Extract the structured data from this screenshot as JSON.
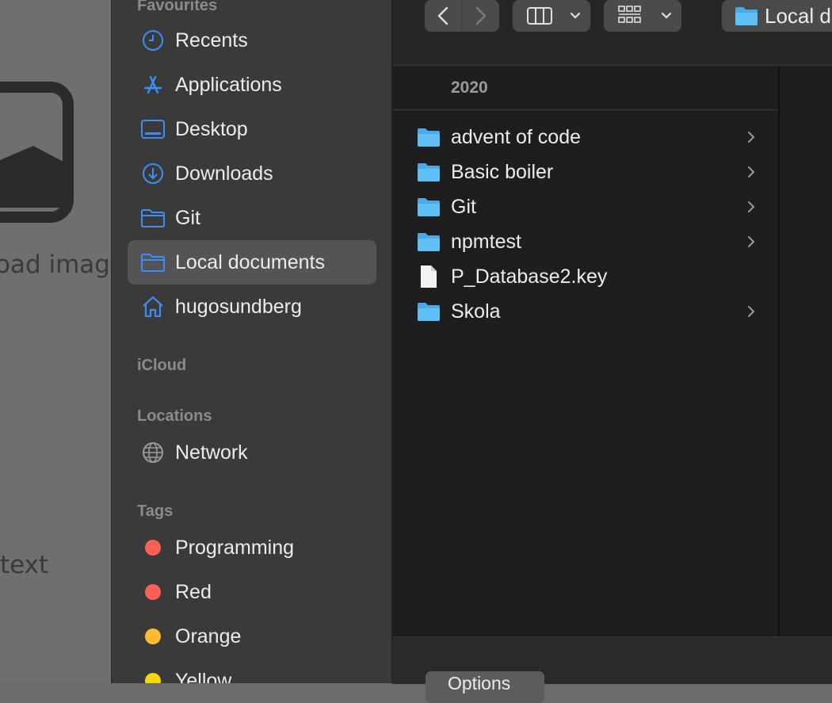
{
  "background": {
    "upload_text": "oad image",
    "text_label": "text"
  },
  "sidebar": {
    "favourites_title": "Favourites",
    "favourites": [
      {
        "label": "Recents",
        "icon": "clock-icon"
      },
      {
        "label": "Applications",
        "icon": "applications-icon"
      },
      {
        "label": "Desktop",
        "icon": "desktop-icon"
      },
      {
        "label": "Downloads",
        "icon": "downloads-icon"
      },
      {
        "label": "Git",
        "icon": "folder-icon"
      },
      {
        "label": "Local documents",
        "icon": "folder-icon",
        "selected": true
      },
      {
        "label": "hugosundberg",
        "icon": "home-icon"
      }
    ],
    "icloud_title": "iCloud",
    "locations_title": "Locations",
    "locations": [
      {
        "label": "Network",
        "icon": "globe-icon"
      }
    ],
    "tags_title": "Tags",
    "tags": [
      {
        "label": "Programming",
        "color": "#ff5f57"
      },
      {
        "label": "Red",
        "color": "#ff5f57"
      },
      {
        "label": "Orange",
        "color": "#febc2e"
      },
      {
        "label": "Yellow",
        "color": "#f5d90a"
      }
    ]
  },
  "toolbar": {
    "back_icon": "chevron-left-icon",
    "forward_icon": "chevron-right-icon",
    "view_icon": "columns-view-icon",
    "group_icon": "grid-group-icon",
    "path_label": "Local documents"
  },
  "column": {
    "header": "2020",
    "items": [
      {
        "label": "advent of code",
        "type": "folder",
        "has_children": true
      },
      {
        "label": "Basic boiler",
        "type": "folder",
        "has_children": true
      },
      {
        "label": "Git",
        "type": "folder",
        "has_children": true
      },
      {
        "label": "npmtest",
        "type": "folder",
        "has_children": true
      },
      {
        "label": "P_Database2.key",
        "type": "file",
        "has_children": false
      },
      {
        "label": "Skola",
        "type": "folder",
        "has_children": true
      }
    ]
  },
  "bottom": {
    "options_label": "Options"
  },
  "colors": {
    "accent": "#3a8ef6",
    "folder": "#5ab8f0",
    "sidebar_bg": "#3a3a3a",
    "main_bg": "#1e1e1e"
  }
}
